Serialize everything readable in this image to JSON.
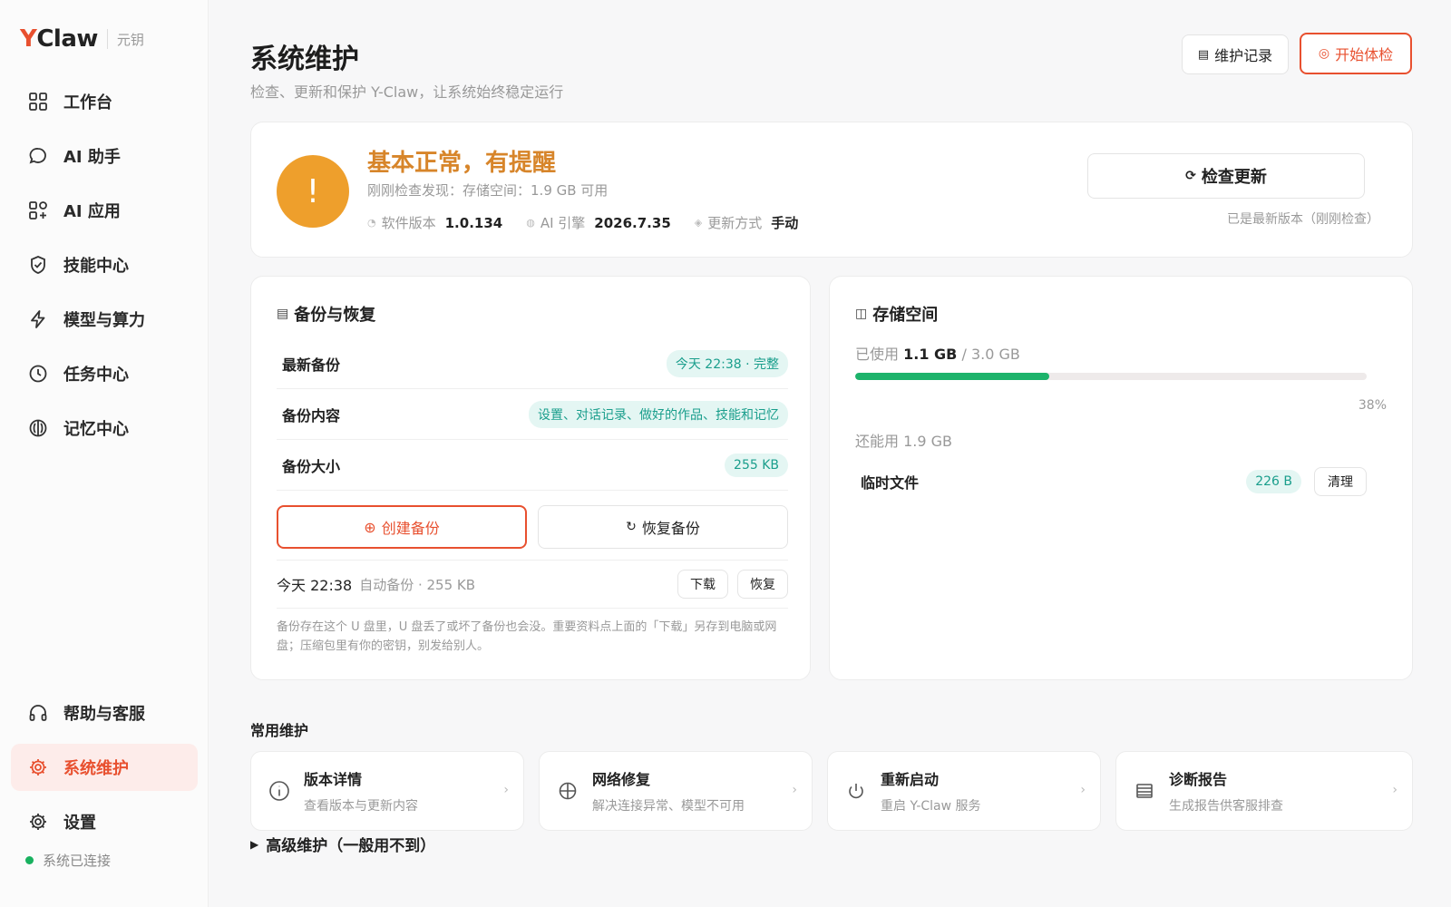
{
  "brand": {
    "y": "Y",
    "name": "Claw",
    "sub": "元钥"
  },
  "sidebar": {
    "items": [
      {
        "label": "工作台",
        "icon": "grid-icon"
      },
      {
        "label": "AI 助手",
        "icon": "chat-bubble-icon"
      },
      {
        "label": "AI 应用",
        "icon": "apps-icon"
      },
      {
        "label": "技能中心",
        "icon": "shield-check-icon"
      },
      {
        "label": "模型与算力",
        "icon": "lightning-icon"
      },
      {
        "label": "任务中心",
        "icon": "clock-icon"
      },
      {
        "label": "记忆中心",
        "icon": "memory-icon"
      }
    ],
    "bottom_items": [
      {
        "label": "帮助与客服",
        "icon": "headset-icon",
        "active": false
      },
      {
        "label": "系统维护",
        "icon": "gear-icon",
        "active": true
      },
      {
        "label": "设置",
        "icon": "gear-icon",
        "active": false
      }
    ],
    "connection": "系统已连接",
    "connection_color": "#18b15f"
  },
  "header": {
    "title": "系统维护",
    "subtitle": "检查、更新和保护 Y-Claw，让系统始终稳定运行",
    "records_button": "维护记录",
    "checkup_button": "开始体检"
  },
  "status": {
    "title": "基本正常，有提醒",
    "desc": "刚刚检查发现：存储空间：1.9 GB 可用",
    "meta": [
      {
        "label": "软件版本",
        "value": "1.0.134"
      },
      {
        "label": "AI 引擎",
        "value": "2026.7.35"
      },
      {
        "label": "更新方式",
        "value": "手动"
      }
    ],
    "update_button": "检查更新",
    "update_hint": "已是最新版本（刚刚检查）",
    "accent_color": "#ee9f2c"
  },
  "backup": {
    "title": "备份与恢复",
    "rows": [
      {
        "label": "最新备份",
        "value": "今天 22:38 · 完整"
      },
      {
        "label": "备份内容",
        "value": "设置、对话记录、做好的作品、技能和记忆"
      },
      {
        "label": "备份大小",
        "value": "255 KB"
      }
    ],
    "create_button": "创建备份",
    "restore_button": "恢复备份",
    "history": {
      "time": "今天 22:38",
      "desc": "自动备份 · 255 KB",
      "download": "下载",
      "restore": "恢复"
    },
    "note": "备份存在这个 U 盘里，U 盘丢了或坏了备份也会没。重要资料点上面的「下载」另存到电脑或网盘；压缩包里有你的密钥，别发给别人。"
  },
  "storage": {
    "title": "存储空间",
    "used_label": "已使用",
    "used": "1.1 GB",
    "total": "3.0 GB",
    "percent": 38,
    "percent_text": "38%",
    "remaining": "还能用 1.9 GB",
    "temp_label": "临时文件",
    "temp_size": "226 B",
    "clean_button": "清理",
    "bar_color": "#1db36b"
  },
  "maintenance": {
    "title": "常用维护",
    "tools": [
      {
        "title": "版本详情",
        "sub": "查看版本与更新内容",
        "icon": "info-icon"
      },
      {
        "title": "网络修复",
        "sub": "解决连接异常、模型不可用",
        "icon": "globe-icon"
      },
      {
        "title": "重新启动",
        "sub": "重启 Y-Claw 服务",
        "icon": "power-icon"
      },
      {
        "title": "诊断报告",
        "sub": "生成报告供客服排查",
        "icon": "report-icon"
      }
    ],
    "advanced": "高级维护（一般用不到）"
  },
  "accent": "#e8502f"
}
